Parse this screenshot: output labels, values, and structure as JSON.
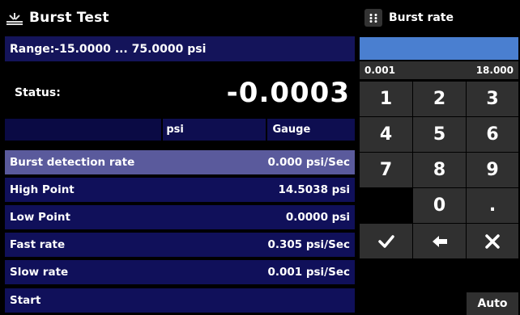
{
  "header": {
    "icon": "burst-test-icon",
    "title": "Burst Test"
  },
  "range": "Range:-15.0000 ... 75.0000 psi",
  "status": {
    "label": "Status:",
    "value": "-0.0003",
    "unit": "psi",
    "mode": "Gauge"
  },
  "rows": [
    {
      "label": "Burst detection rate",
      "value": "0.000 psi/Sec",
      "selected": true
    },
    {
      "label": "High Point",
      "value": "14.5038 psi"
    },
    {
      "label": "Low Point",
      "value": "0.0000 psi"
    },
    {
      "label": "Fast rate",
      "value": "0.305 psi/Sec"
    },
    {
      "label": "Slow rate",
      "value": "0.001 psi/Sec"
    },
    {
      "label": "Start",
      "value": ""
    }
  ],
  "keypad": {
    "icon": "keypad-grid-icon",
    "title": "Burst rate",
    "input_value": "",
    "min": "0.001",
    "max": "18.000",
    "keys": [
      "1",
      "2",
      "3",
      "4",
      "5",
      "6",
      "7",
      "8",
      "9",
      "",
      "0",
      "."
    ],
    "actions": {
      "enter": "check-icon",
      "backspace": "left-arrow-icon",
      "cancel": "close-icon"
    },
    "auto_label": "Auto"
  },
  "colors": {
    "row_bg": "#10105a",
    "row_selected": "#5a5a9c",
    "input_bg": "#4a7fd0",
    "key_bg": "#303030"
  }
}
